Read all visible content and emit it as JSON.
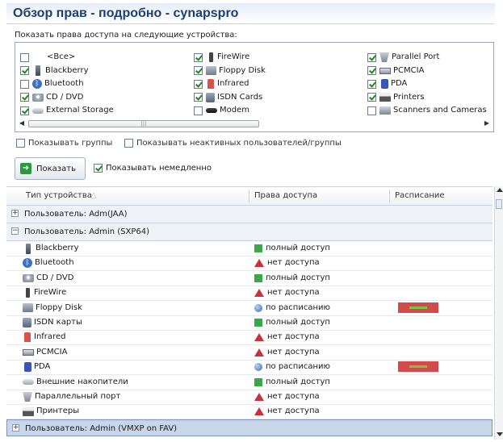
{
  "title": "Обзор прав - подробно - cynapspro",
  "subtitle": "Показать права доступа на следующие устройства:",
  "devices": [
    {
      "label": "<Все>",
      "checked": false,
      "icon": "none-icon"
    },
    {
      "label": "Blackberry",
      "checked": true,
      "icon": "blackberry-icon"
    },
    {
      "label": "Bluetooth",
      "checked": false,
      "icon": "bluetooth-icon"
    },
    {
      "label": "CD / DVD",
      "checked": true,
      "icon": "cd-dvd-icon"
    },
    {
      "label": "External Storage",
      "checked": true,
      "icon": "external-storage-icon"
    },
    {
      "label": "FireWire",
      "checked": true,
      "icon": "firewire-icon"
    },
    {
      "label": "Floppy Disk",
      "checked": true,
      "icon": "floppy-disk-icon"
    },
    {
      "label": "Infrared",
      "checked": true,
      "icon": "infrared-icon"
    },
    {
      "label": "ISDN Cards",
      "checked": true,
      "icon": "isdn-icon"
    },
    {
      "label": "Modem",
      "checked": false,
      "icon": "modem-icon"
    },
    {
      "label": "Parallel Port",
      "checked": true,
      "icon": "parallel-port-icon"
    },
    {
      "label": "PCMCIA",
      "checked": true,
      "icon": "pcmcia-icon"
    },
    {
      "label": "PDA",
      "checked": true,
      "icon": "pda-icon"
    },
    {
      "label": "Printers",
      "checked": true,
      "icon": "printer-icon"
    },
    {
      "label": "Scanners and Cameras",
      "checked": false,
      "icon": "scanner-icon"
    }
  ],
  "options": {
    "show_groups": {
      "label": "Показывать группы",
      "checked": false
    },
    "show_inactive": {
      "label": "Показывать неактивных пользователей/группы",
      "checked": false
    },
    "show_button": "Показать",
    "show_immediately": {
      "label": "Показывать немедленно",
      "checked": true
    }
  },
  "grid": {
    "columns": [
      "Тип устройства",
      "Права доступа",
      "Расписание"
    ],
    "groups": [
      {
        "label": "Пользователь: Adm(JAA)",
        "expanded": false,
        "selected": false,
        "rows": []
      },
      {
        "label": "Пользователь: Admin (SXP64)",
        "expanded": true,
        "selected": false,
        "rows": [
          {
            "device": "Blackberry",
            "icon": "blackberry-icon",
            "access": "полный доступ",
            "status": "full",
            "schedule": false
          },
          {
            "device": "Bluetooth",
            "icon": "bluetooth-icon",
            "access": "нет доступа",
            "status": "none",
            "schedule": false
          },
          {
            "device": "CD / DVD",
            "icon": "cd-dvd-icon",
            "access": "полный доступ",
            "status": "full",
            "schedule": false
          },
          {
            "device": "FireWire",
            "icon": "firewire-icon",
            "access": "нет доступа",
            "status": "none",
            "schedule": false
          },
          {
            "device": "Floppy Disk",
            "icon": "floppy-disk-icon",
            "access": "по расписанию",
            "status": "sched",
            "schedule": true
          },
          {
            "device": "ISDN карты",
            "icon": "isdn-icon",
            "access": "полный доступ",
            "status": "full",
            "schedule": false
          },
          {
            "device": "Infrared",
            "icon": "infrared-icon",
            "access": "нет доступа",
            "status": "none",
            "schedule": false
          },
          {
            "device": "PCMCIA",
            "icon": "pcmcia-icon",
            "access": "нет доступа",
            "status": "none",
            "schedule": false
          },
          {
            "device": "PDA",
            "icon": "pda-icon",
            "access": "по расписанию",
            "status": "sched",
            "schedule": true
          },
          {
            "device": "Внешние накопители",
            "icon": "external-storage-icon",
            "access": "полный доступ",
            "status": "full",
            "schedule": false
          },
          {
            "device": "Параллельный порт",
            "icon": "parallel-port-icon",
            "access": "нет доступа",
            "status": "none",
            "schedule": false
          },
          {
            "device": "Принтеры",
            "icon": "printer-icon",
            "access": "нет доступа",
            "status": "none",
            "schedule": false
          }
        ]
      },
      {
        "label": "Пользователь: Admin (VMXP on FAV)",
        "expanded": false,
        "selected": true,
        "rows": []
      }
    ]
  },
  "colors": {
    "title": "#1d3f73",
    "full_access": "#3aa84a",
    "no_access": "#c8323a",
    "schedule_bar": "#d24a4a",
    "selection": "#c8d6ea"
  }
}
